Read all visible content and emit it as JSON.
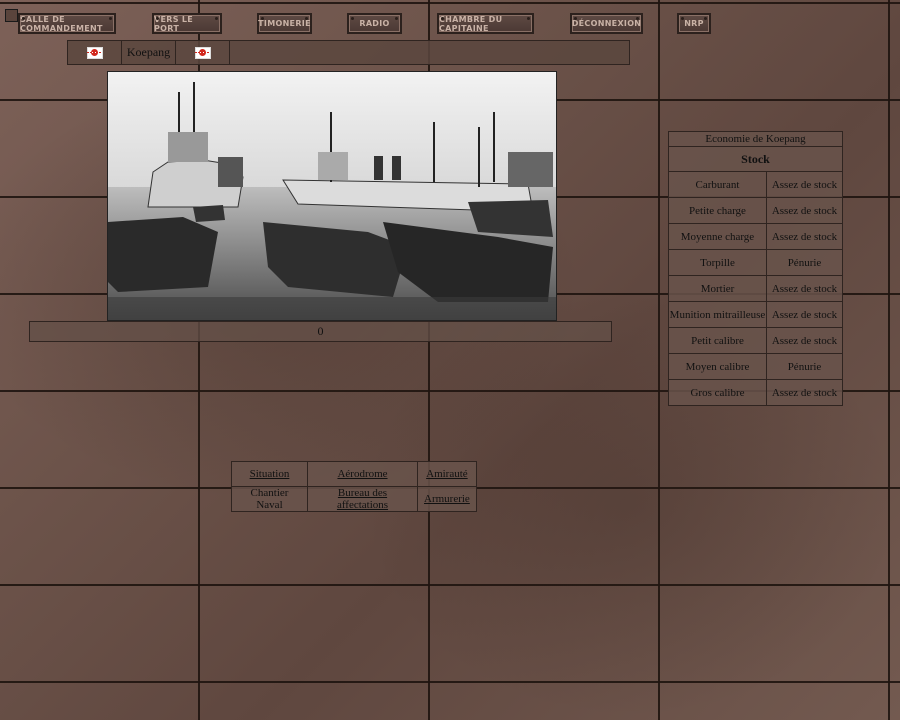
{
  "topnav": [
    {
      "label": "Salle de commandement"
    },
    {
      "label": "Vers le port"
    },
    {
      "label": "Timonerie"
    },
    {
      "label": "Radio"
    },
    {
      "label": "Chambre du capitaine"
    },
    {
      "label": "Déconnexion"
    },
    {
      "label": "NRP"
    }
  ],
  "header": {
    "port_name": "Koepang"
  },
  "counter": {
    "value": "0"
  },
  "economy": {
    "title": "Economie de Koepang",
    "stock_header": "Stock",
    "items": [
      {
        "name": "Carburant",
        "status": "Assez de stock"
      },
      {
        "name": "Petite charge",
        "status": "Assez de stock"
      },
      {
        "name": "Moyenne charge",
        "status": "Assez de stock"
      },
      {
        "name": "Torpille",
        "status": "Pénurie"
      },
      {
        "name": "Mortier",
        "status": "Assez de stock"
      },
      {
        "name": "Munition mitrailleuse",
        "status": "Assez de stock"
      },
      {
        "name": "Petit calibre",
        "status": "Assez de stock"
      },
      {
        "name": "Moyen calibre",
        "status": "Pénurie"
      },
      {
        "name": "Gros calibre",
        "status": "Assez de stock"
      }
    ]
  },
  "menu": {
    "row1": [
      "Situation",
      "Aérodrome",
      "Amirauté"
    ],
    "row2": [
      "Chantier Naval",
      "Bureau des affectations",
      "Armurerie"
    ]
  },
  "colors": {
    "flag_red": "#d2281e",
    "panel": "#69534b",
    "border": "#2f2420"
  }
}
